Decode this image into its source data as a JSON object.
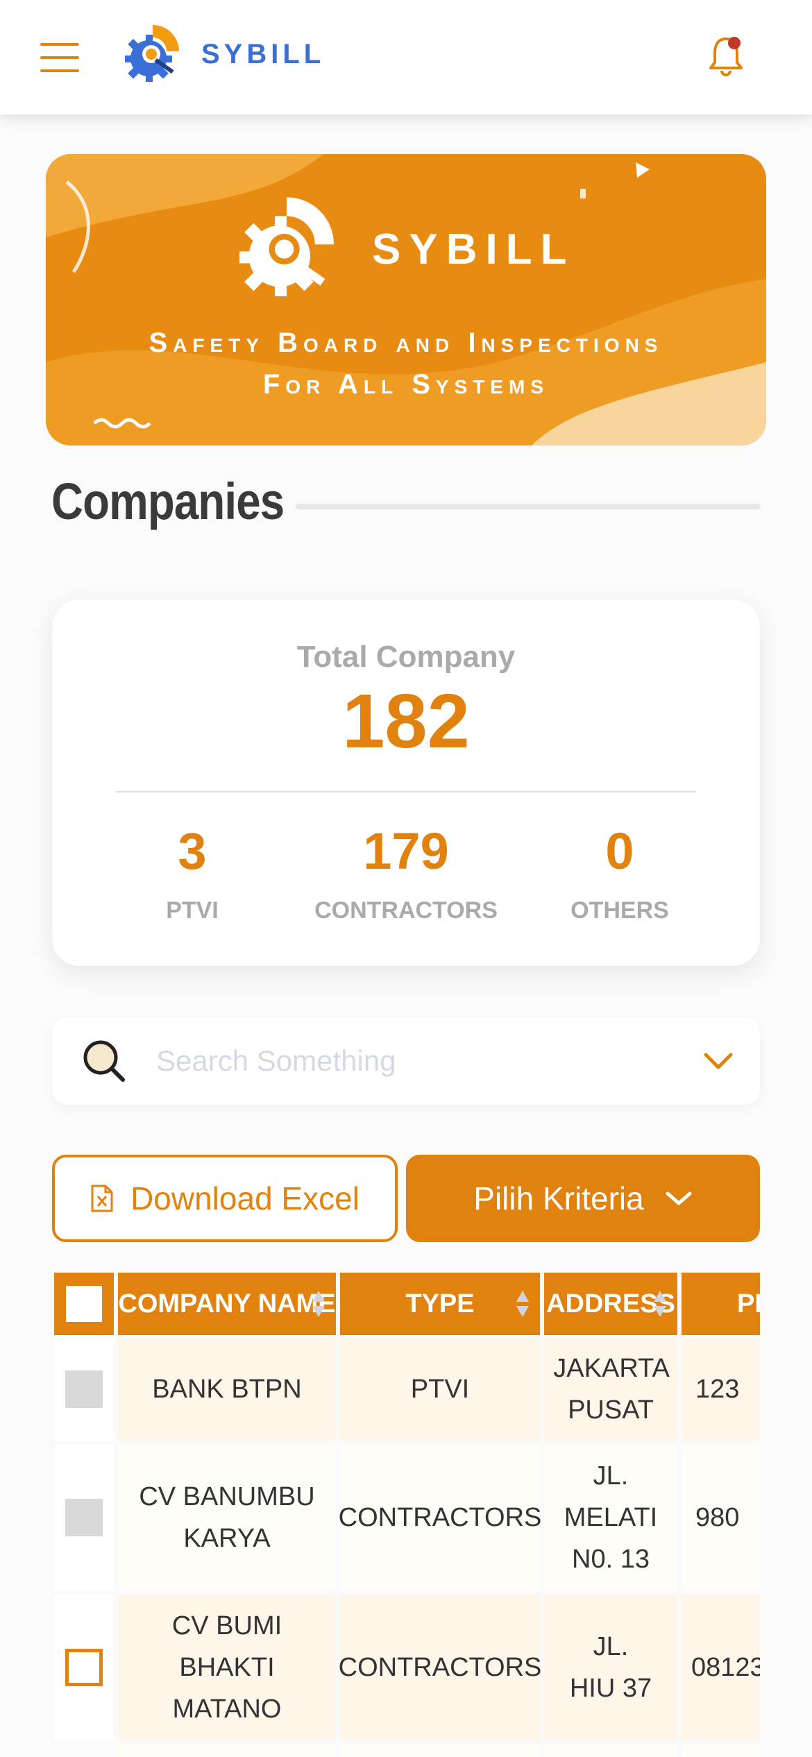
{
  "header": {
    "brand": "SYBILL",
    "menu_icon": "hamburger-menu-icon",
    "notification_icon": "bell-icon",
    "colors": {
      "accent": "#e2820e",
      "brand_blue": "#3a6fd8",
      "notification_dot": "#c0392b"
    }
  },
  "banner": {
    "title": "SYBILL",
    "subtitle_line1": "Safety Board and Inspections",
    "subtitle_line2": "For All Systems"
  },
  "section": {
    "title": "Companies"
  },
  "stats": {
    "total_label": "Total Company",
    "total_value": "182",
    "items": [
      {
        "value": "3",
        "label": "PTVI"
      },
      {
        "value": "179",
        "label": "CONTRACTORS"
      },
      {
        "value": "0",
        "label": "OTHERS"
      }
    ]
  },
  "search": {
    "placeholder": "Search Something"
  },
  "actions": {
    "download_label": "Download Excel",
    "criteria_label": "Pilih Kriteria"
  },
  "table": {
    "columns": [
      "COMPANY NAME",
      "TYPE",
      "ADDRESS",
      "PHONE"
    ],
    "rows": [
      {
        "name": "BANK BTPN",
        "type": "PTVI",
        "address": "JAKARTA PUSAT",
        "phone": "123",
        "checkbox": "grey"
      },
      {
        "name": "CV BANUMBU KARYA",
        "type": "CONTRACTORS",
        "address": "JL. MELATI N0. 13",
        "phone": "980",
        "checkbox": "grey"
      },
      {
        "name": "CV BUMI BHAKTI MATANO",
        "type": "CONTRACTORS",
        "address": "JL. HIU 37",
        "phone": "08123",
        "checkbox": "empty"
      }
    ]
  }
}
